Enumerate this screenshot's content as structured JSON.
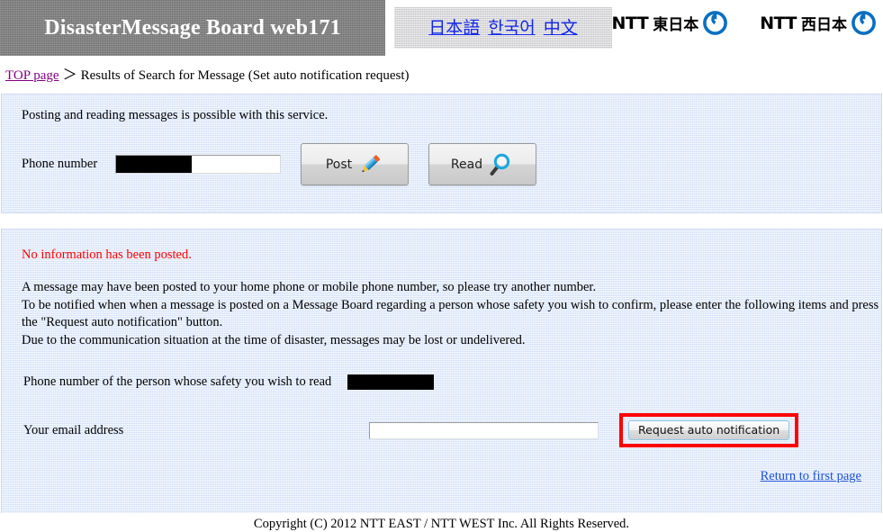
{
  "header": {
    "site_title": "DisasterMessage Board web171",
    "languages": [
      {
        "label": "日本語",
        "name": "lang-japanese"
      },
      {
        "label": "한국어",
        "name": "lang-korean"
      },
      {
        "label": "中文",
        "name": "lang-chinese"
      }
    ],
    "logos": [
      {
        "word": "NTT",
        "region": "東日本",
        "icon": "ntt-circle-icon"
      },
      {
        "word": "NTT",
        "region": "西日本",
        "icon": "ntt-circle-icon"
      }
    ]
  },
  "breadcrumb": {
    "home_label": "TOP page",
    "separator": "＞",
    "current": "Results of Search for Message (Set auto notification request)"
  },
  "search_panel": {
    "intro": "Posting and reading messages is possible with this service.",
    "phone_label": "Phone number",
    "phone_value": "",
    "phone_placeholder": "",
    "post_button": "Post",
    "post_icon": "pencil-icon",
    "read_button": "Read",
    "read_icon": "magnifier-icon"
  },
  "results_panel": {
    "error_message": "No information has been posted.",
    "paragraphs": [
      "A message may have been posted to your home phone or mobile phone number, so please try another number.",
      "To be notified when when a message is posted on a Message Board regarding a person whose safety you wish to confirm, please enter the following items and press the \"Request auto notification\" button.",
      "Due to the communication situation at the time of disaster, messages may be lost or undelivered."
    ],
    "safety_phone_label": "Phone number of the person whose safety you wish to read",
    "safety_phone_value": "",
    "email_label": "Your email address",
    "email_value": "",
    "email_placeholder": "",
    "notify_button": "Request auto notification",
    "return_link": "Return to first page"
  },
  "footer": {
    "copyright": "Copyright (C) 2012 NTT EAST / NTT WEST Inc. All Rights Reserved."
  },
  "colors": {
    "panel_bg": "#e3ecfb",
    "header_bar": "#808080",
    "link_blue": "#1326e8",
    "visited_purple": "#800080",
    "error_red": "#ff0000",
    "highlight_red": "#ff0000",
    "ntt_blue": "#0a6fc2"
  }
}
